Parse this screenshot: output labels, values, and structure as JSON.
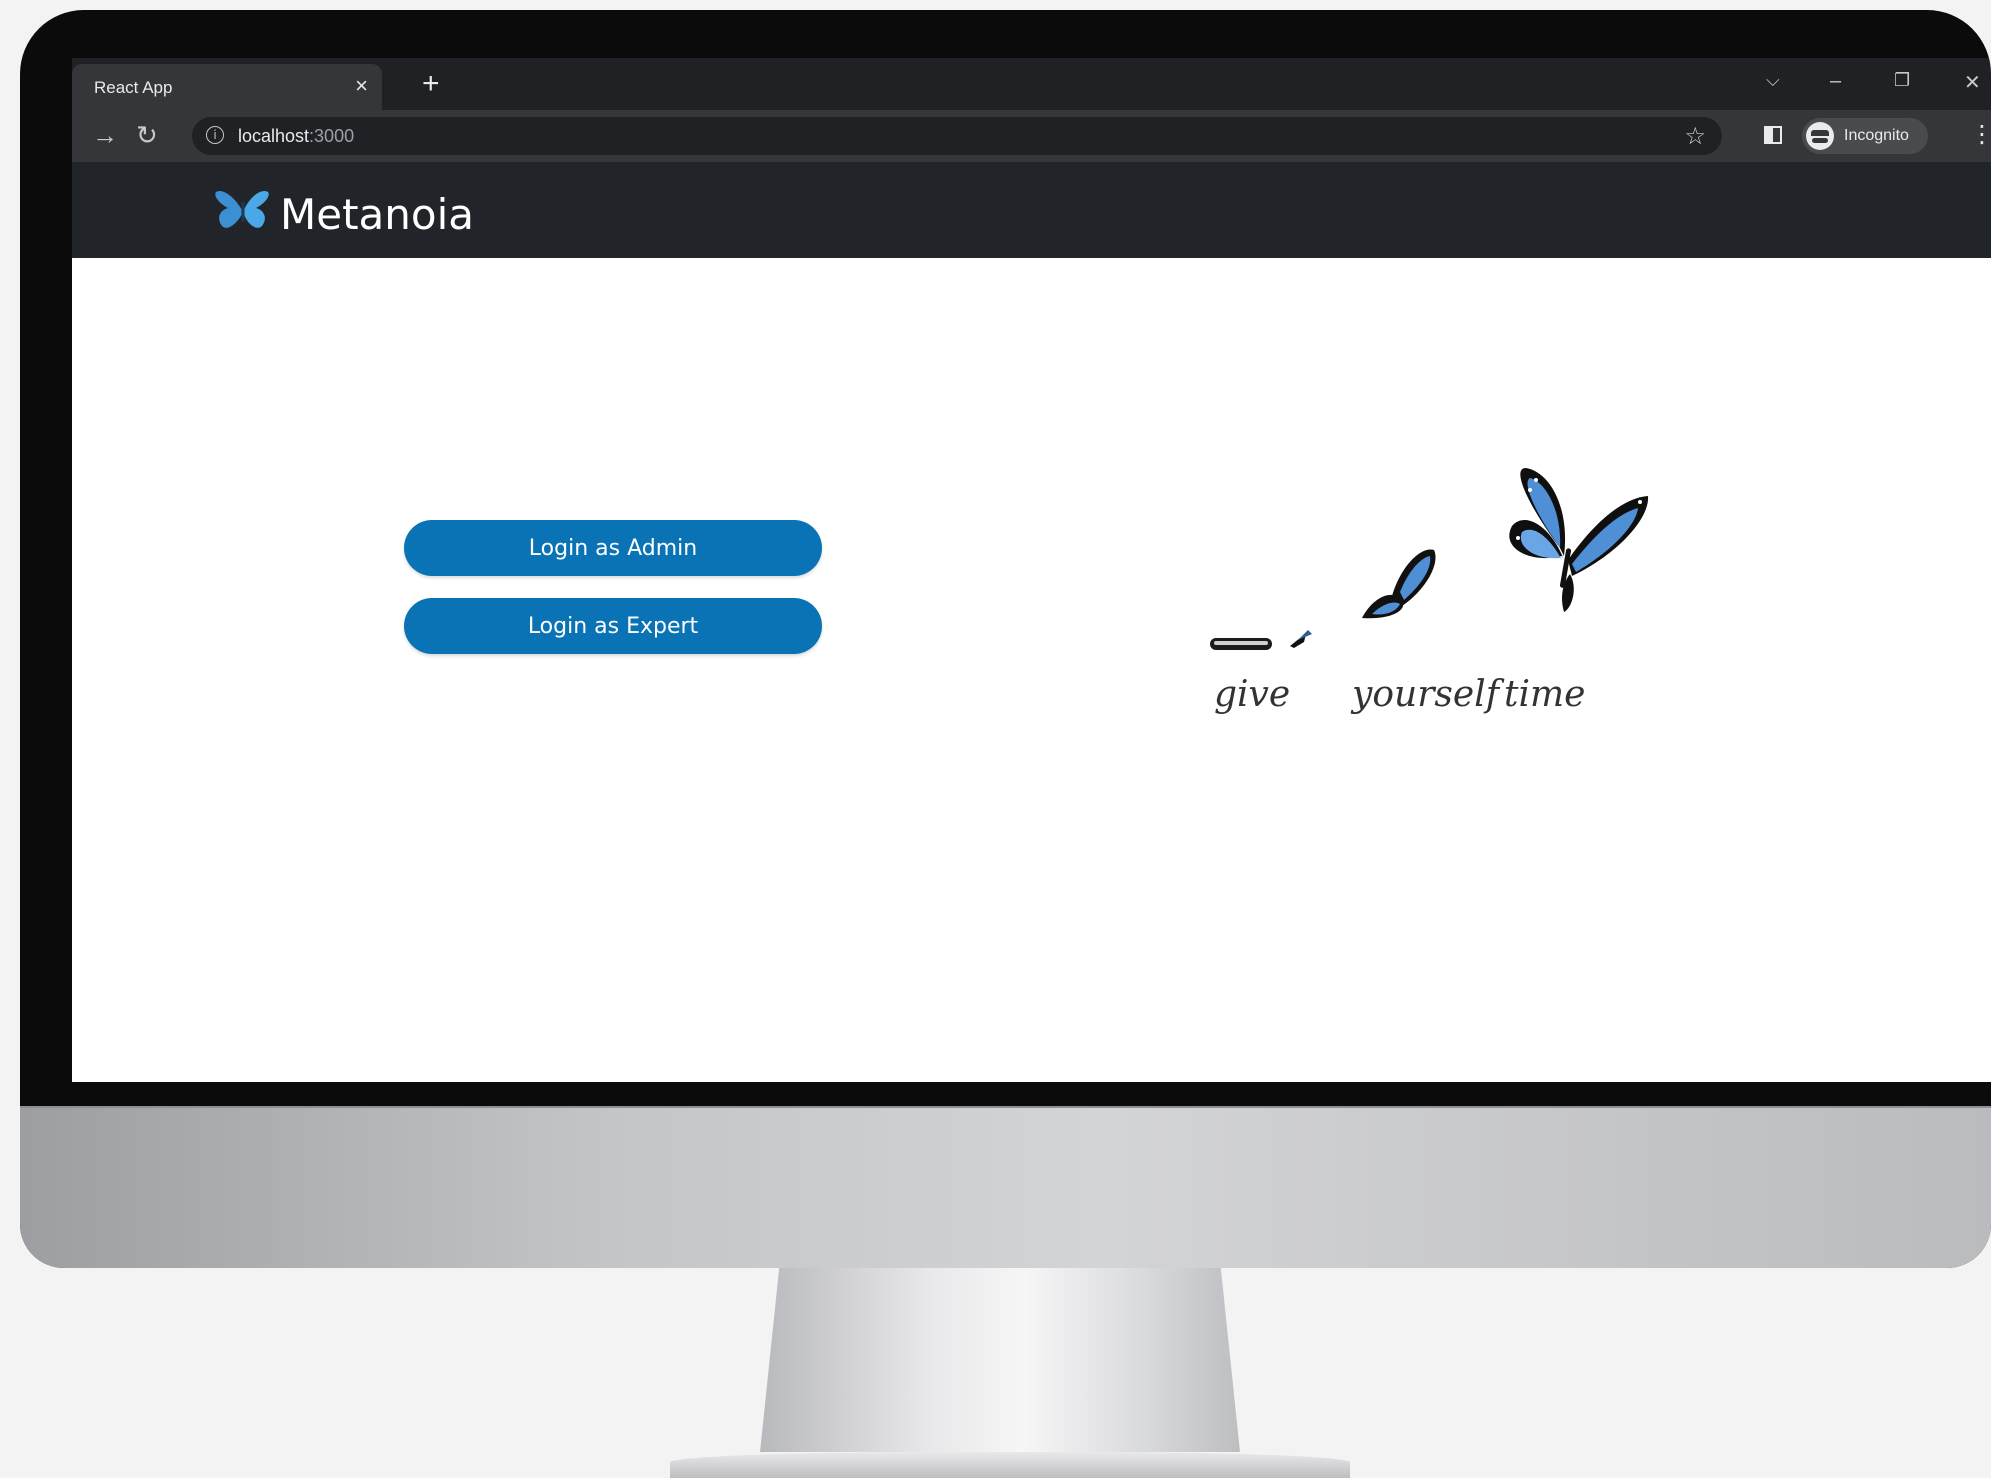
{
  "browser": {
    "tab_title": "React App",
    "tab_close": "×",
    "new_tab": "+",
    "url_host": "localhost",
    "url_port": ":3000",
    "incognito_label": "Incognito"
  },
  "app": {
    "brand": "Metanoia",
    "buttons": {
      "admin": "Login as Admin",
      "expert": "Login as Expert"
    },
    "illustration": {
      "words": [
        "give",
        "yourself",
        "time"
      ]
    }
  },
  "colors": {
    "navbar": "#212529",
    "button": "#0a73b5",
    "butterfly": "#4f8fd6"
  }
}
